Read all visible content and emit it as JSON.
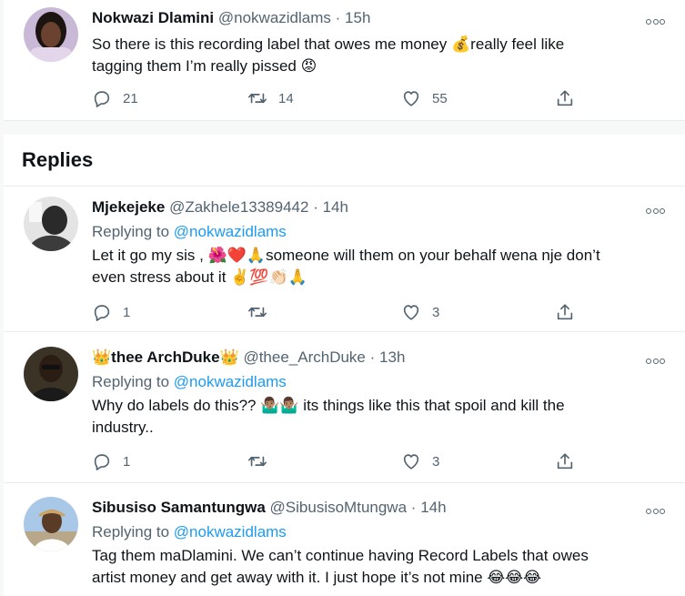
{
  "main_tweet": {
    "name": "Nokwazi Dlamini",
    "handle": "@nokwazidlams",
    "dot": "·",
    "time": "15h",
    "line1": "So there is this recording label that owes me money ",
    "emoji1": "💰",
    "line1b": "really feel like",
    "line2": "tagging them I’m really pissed ",
    "emoji2": "😡",
    "reply_count": "21",
    "retweet_count": "14",
    "like_count": "55"
  },
  "replies_header": "Replies",
  "replying_to_label": "Replying to ",
  "replies": [
    {
      "name": "Mjekejeke",
      "handle": "@Zakhele13389442",
      "dot": "·",
      "time": "14h",
      "replying_to": "@nokwazidlams",
      "line1": "Let it go my sis , ",
      "emoji_a": "🌺❤️🙏",
      "line1b": "someone will them on your behalf wena nje don’t",
      "line2": "even stress about it ",
      "emoji_b": "✌️💯👏🏻🙏",
      "reply_count": "1",
      "retweet_count": "",
      "like_count": "3"
    },
    {
      "name_prefix_emoji": "👑",
      "name": "thee ArchDuke",
      "name_suffix_emoji": "👑",
      "handle": "@thee_ArchDuke",
      "dot": "·",
      "time": "13h",
      "replying_to": "@nokwazidlams",
      "line1": "Why do labels do this?? ",
      "emoji_a": "🤷🏽‍♂️🤷🏽‍♂️",
      "line1b": " its things like this that spoil and kill the",
      "line2": "industry..",
      "reply_count": "1",
      "retweet_count": "",
      "like_count": "3"
    },
    {
      "name": "Sibusiso Samantungwa",
      "handle": "@SibusisoMtungwa",
      "dot": "·",
      "time": "14h",
      "replying_to": "@nokwazidlams",
      "line1": "Tag them maDlamini. We can’t continue having Record Labels that owes",
      "line2": "artist money and get away with it. I just hope it’s not mine ",
      "emoji_b": "😂😂😂"
    }
  ],
  "icons": {
    "reply": "reply-bubble-icon",
    "retweet": "retweet-icon",
    "like": "heart-icon",
    "share": "share-icon",
    "more": "more-dots-icon"
  },
  "colors": {
    "link": "#1d9bf0",
    "secondary": "#536471",
    "text": "#0f1419",
    "border": "#e6ecf0",
    "background": "#f7f9f9"
  }
}
